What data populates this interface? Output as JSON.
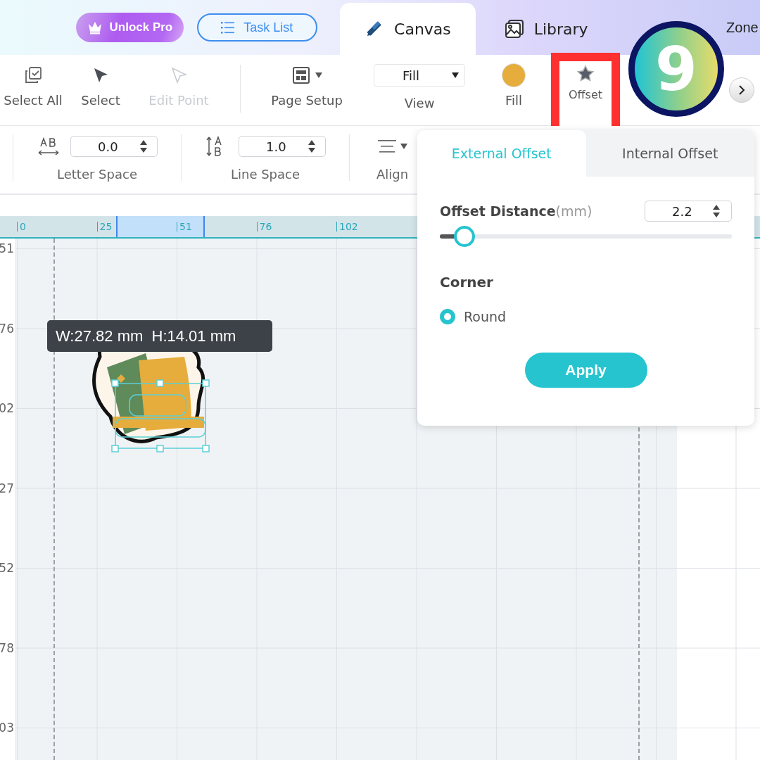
{
  "header": {
    "pro_button": "Unlock Pro",
    "task_button": "Task List",
    "tabs": [
      {
        "label": "Canvas",
        "kind": "canvas",
        "selected": true
      },
      {
        "label": "Library",
        "kind": "library",
        "selected": false
      },
      {
        "label": "Zone",
        "kind": "zone",
        "selected": false
      }
    ]
  },
  "step_badge": "9",
  "toolbar": [
    {
      "label": "Select All",
      "kind": "select-all",
      "disabled": false,
      "highlighted": false
    },
    {
      "label": "Select",
      "kind": "select",
      "disabled": false,
      "highlighted": false
    },
    {
      "label": "Edit Point",
      "kind": "edit-point",
      "disabled": true,
      "highlighted": false
    },
    {
      "label": "Page Setup",
      "kind": "page-setup",
      "disabled": false,
      "highlighted": false
    },
    {
      "label": "View",
      "kind": "view",
      "value": "Fill",
      "disabled": false,
      "highlighted": false
    },
    {
      "label": "Fill",
      "kind": "fill",
      "color": "#e6ad3c",
      "disabled": false,
      "highlighted": false
    },
    {
      "label": "Offset",
      "kind": "offset",
      "disabled": false,
      "highlighted": true
    }
  ],
  "text_toolbar": {
    "letter_space": {
      "value": "0.0",
      "label": "Letter Space"
    },
    "line_space": {
      "value": "1.0",
      "label": "Line Space"
    },
    "align": {
      "label": "Align"
    }
  },
  "ruler": {
    "x_labels": [
      "0",
      "25",
      "51",
      "76",
      "102"
    ],
    "y_labels": [
      "51",
      "76",
      "02",
      "27",
      "52",
      "78",
      "03"
    ]
  },
  "selection_size": "W:27.82 mm  H:14.01 mm",
  "offset_panel": {
    "tabs": [
      {
        "label": "External Offset",
        "selected": true
      },
      {
        "label": "Internal Offset",
        "selected": false
      }
    ],
    "distance_label": "Offset Distance",
    "distance_unit": "(mm)",
    "distance_value": "2.2",
    "level": 0.085,
    "corner_label": "Corner",
    "corners": [
      {
        "label": "Round",
        "selected": true
      }
    ],
    "apply": "Apply"
  }
}
